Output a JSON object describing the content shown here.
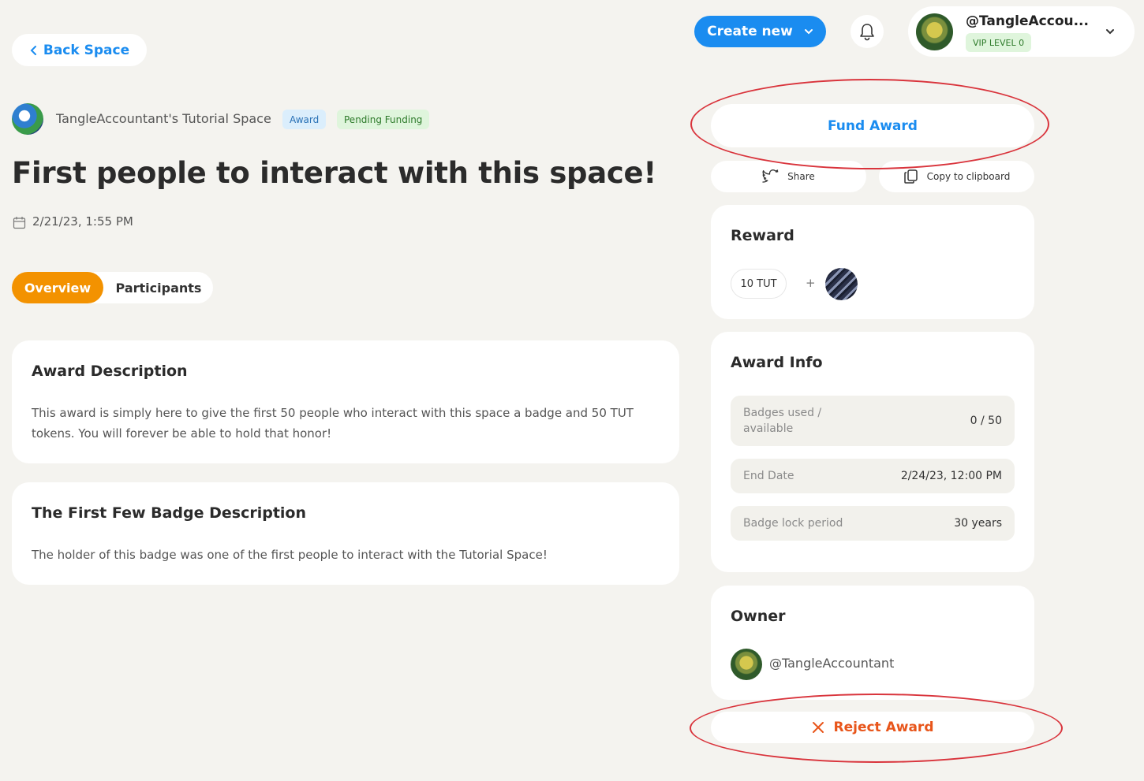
{
  "header": {
    "back_label": "Back Space",
    "create_label": "Create new",
    "profile": {
      "username": "@TangleAccou...",
      "vip_level": "VIP LEVEL 0"
    }
  },
  "award": {
    "space_name": "TangleAccountant's Tutorial Space",
    "tag_type": "Award",
    "tag_status": "Pending Funding",
    "title": "First people to interact with this space!",
    "date": "2/21/23, 1:55 PM"
  },
  "tabs": {
    "overview": "Overview",
    "participants": "Participants"
  },
  "description": {
    "title": "Award Description",
    "text": "This award is simply here to give the first 50 people who interact with this space a badge and 50 TUT tokens. You will forever be able to hold that honor!"
  },
  "badge": {
    "title": "The First Few Badge Description",
    "text": "The holder of this badge was one of the first people to interact with the Tutorial Space!"
  },
  "actions": {
    "fund": "Fund Award",
    "share": "Share",
    "copy": "Copy to clipboard",
    "reject": "Reject Award"
  },
  "reward": {
    "title": "Reward",
    "token": "10 TUT",
    "plus": "+"
  },
  "info": {
    "title": "Award Info",
    "rows": [
      {
        "label": "Badges used / available",
        "value": "0 / 50"
      },
      {
        "label": "End Date",
        "value": "2/24/23, 12:00 PM"
      },
      {
        "label": "Badge lock period",
        "value": "30 years"
      }
    ]
  },
  "owner": {
    "title": "Owner",
    "name": "@TangleAccountant"
  },
  "colors": {
    "accent_blue": "#1a8cf0",
    "accent_orange": "#f39200",
    "reject_orange": "#e8551a",
    "annotation_red": "#d9343c",
    "background": "#f4f3ef"
  },
  "icons": [
    "chevron-left-icon",
    "chevron-down-icon",
    "bell-icon",
    "calendar-icon",
    "twitter-icon",
    "copy-icon",
    "close-icon"
  ]
}
